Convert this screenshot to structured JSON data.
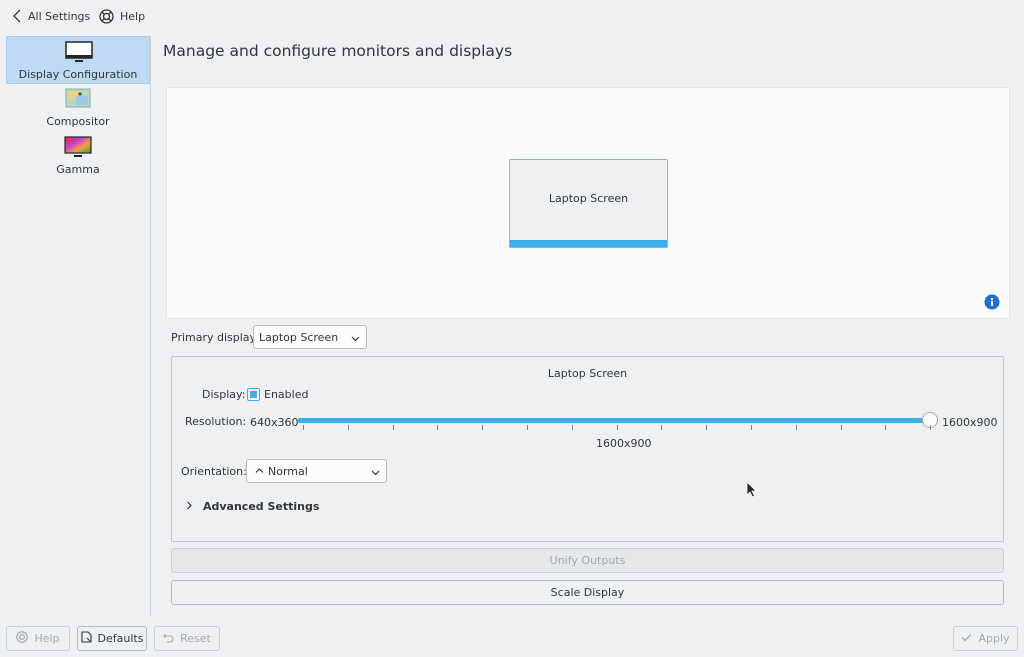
{
  "topbar": {
    "all_settings": "All Settings",
    "help": "Help"
  },
  "sidebar": {
    "items": [
      {
        "label": "Display Configuration",
        "icon": "monitor-icon",
        "active": true
      },
      {
        "label": "Compositor",
        "icon": "compositor-icon",
        "active": false
      },
      {
        "label": "Gamma",
        "icon": "gamma-icon",
        "active": false
      }
    ]
  },
  "page": {
    "title": "Manage and configure monitors and displays"
  },
  "canvas": {
    "screen_name": "Laptop Screen"
  },
  "primary": {
    "label": "Primary display:",
    "value": "Laptop Screen"
  },
  "output": {
    "title": "Laptop Screen",
    "display_label": "Display:",
    "enabled_label": "Enabled",
    "enabled": true,
    "resolution_label": "Resolution:",
    "res_min": "640x360",
    "res_max": "1600x900",
    "res_current": "1600x900",
    "resolution_fraction": 1.0,
    "orientation_label": "Orientation:",
    "orientation_value": "Normal",
    "advanced_label": "Advanced Settings"
  },
  "actions": {
    "unify": "Unify Outputs",
    "scale": "Scale Display"
  },
  "bottom": {
    "help": "Help",
    "defaults": "Defaults",
    "reset": "Reset",
    "apply": "Apply"
  },
  "colors": {
    "accent": "#3daee9",
    "selection": "#bfdaf2",
    "window_bg": "#eff0f1",
    "text": "#31363b"
  }
}
